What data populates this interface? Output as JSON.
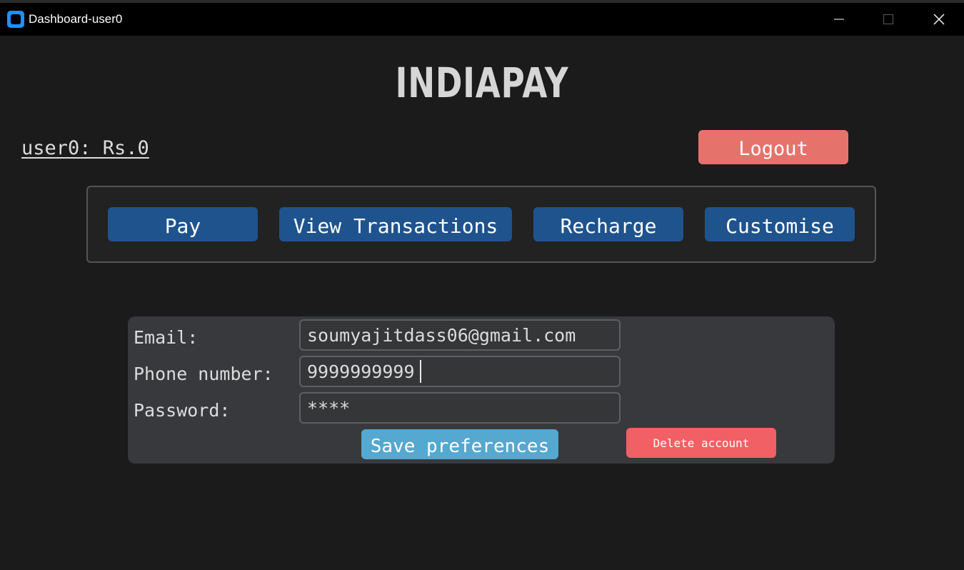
{
  "window": {
    "title": "Dashboard-user0",
    "icons": {
      "app": "app-icon",
      "minimize": "minimize-icon",
      "maximize": "maximize-icon",
      "close": "close-icon"
    }
  },
  "header": {
    "logo": "INDIAPAY",
    "balance": "user0: Rs.0",
    "logout_label": "Logout"
  },
  "nav": {
    "pay_label": "Pay",
    "transactions_label": "View Transactions",
    "recharge_label": "Recharge",
    "customise_label": "Customise"
  },
  "preferences": {
    "email_label": "Email:",
    "email_value": "soumyajitdass06@gmail.com",
    "phone_label": "Phone number:",
    "phone_value": "9999999999",
    "password_label": "Password:",
    "password_value": "****",
    "save_label": "Save preferences",
    "delete_label": "Delete account"
  },
  "colors": {
    "background": "#1b1b1b",
    "logout": "#e5736c",
    "nav_button": "#1f538d",
    "save_button": "#55a8cf",
    "delete_button": "#f16065",
    "panel": "#38393c"
  }
}
